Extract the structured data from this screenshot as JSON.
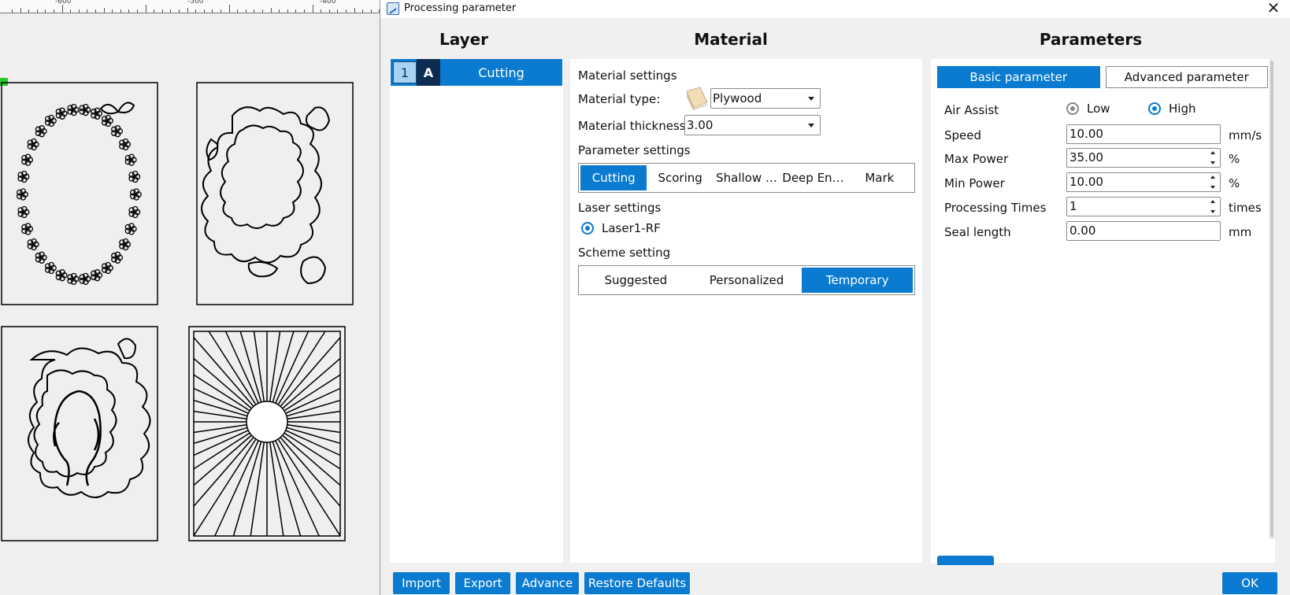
{
  "window": {
    "title": "Processing parameter",
    "close_glyph": "✕"
  },
  "canvas": {
    "ruler_labels": [
      "-600",
      "-500",
      "-400"
    ],
    "designs": [
      "floral-wreath",
      "butterfly-cloud-frame",
      "mother-child-frame",
      "sunburst"
    ]
  },
  "columns": {
    "layer": "Layer",
    "material": "Material",
    "parameters": "Parameters"
  },
  "layer_list": [
    {
      "number": "1",
      "mode": "A",
      "name": "Cutting"
    }
  ],
  "material": {
    "settings_title": "Material settings",
    "type_label": "Material type:",
    "type_value": "Plywood",
    "thickness_label": "Material thickness:",
    "thickness_value": "3.00",
    "param_settings_title": "Parameter settings",
    "param_tabs": [
      "Cutting",
      "Scoring",
      "Shallow …",
      "Deep En…",
      "Mark"
    ],
    "param_tabs_active": 0,
    "laser_settings_title": "Laser settings",
    "laser_option": "Laser1-RF",
    "scheme_title": "Scheme setting",
    "scheme_tabs": [
      "Suggested",
      "Personalized",
      "Temporary"
    ],
    "scheme_tabs_active": 2
  },
  "parameters": {
    "tab_basic": "Basic parameter",
    "tab_advanced": "Advanced parameter",
    "air_assist_label": "Air Assist",
    "air_low": "Low",
    "air_high": "High",
    "air_selected": "High",
    "speed_label": "Speed",
    "speed_value": "10.00",
    "speed_unit": "mm/s",
    "max_power_label": "Max Power",
    "max_power_value": "35.00",
    "max_power_unit": "%",
    "min_power_label": "Min Power",
    "min_power_value": "10.00",
    "min_power_unit": "%",
    "times_label": "Processing Times",
    "times_value": "1",
    "times_unit": "times",
    "seal_label": "Seal length",
    "seal_value": "0.00",
    "seal_unit": "mm"
  },
  "footer": {
    "import": "Import",
    "export": "Export",
    "advance": "Advance",
    "restore": "Restore Defaults",
    "ok": "OK"
  },
  "colors": {
    "accent": "#0a7bd0",
    "layer_mode_bg": "#0d2c52",
    "panel_bg": "#ffffff",
    "dialog_bg": "#f0f0f0"
  }
}
